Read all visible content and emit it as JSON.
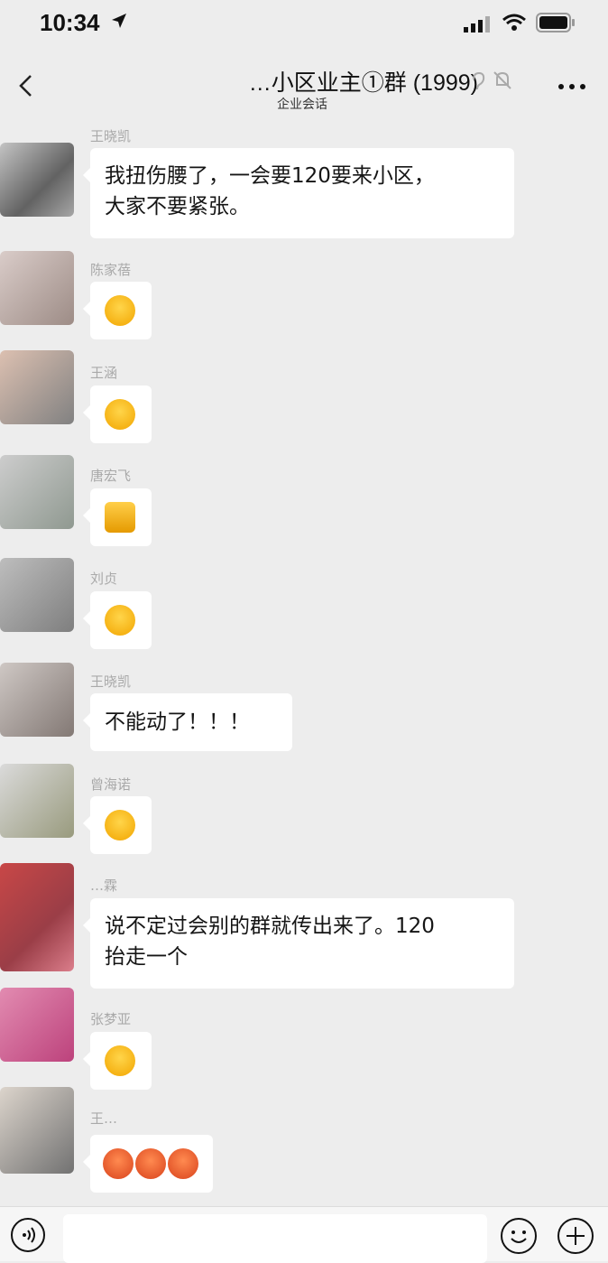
{
  "status_bar": {
    "time": "10:34"
  },
  "header": {
    "title": "…小区业主①群 (1999)",
    "subtitle": "企业会话",
    "icons": [
      "back-chevron-icon",
      "ear-icon",
      "mute-bell-icon",
      "more-icon"
    ]
  },
  "messages": [
    {
      "sender": "王晓凯",
      "text": "我扭伤腰了，一会要120要来小区，\n大家不要紧张。",
      "type": "text"
    },
    {
      "sender": "陈家蓓",
      "emoji": "facepalm-laugh-emoji",
      "type": "emoji"
    },
    {
      "sender": "王涵",
      "emoji": "facepalm-laugh-emoji",
      "type": "emoji"
    },
    {
      "sender": "唐宏飞",
      "emoji": "thumbs-up-emoji",
      "type": "emoji"
    },
    {
      "sender": "刘贞",
      "emoji": "grin-emoji",
      "type": "emoji"
    },
    {
      "sender": "王晓凯",
      "text": "不能动了！！！",
      "type": "text"
    },
    {
      "sender": "曾海诺",
      "emoji": "grin-sweat-emoji",
      "type": "emoji"
    },
    {
      "sender": "…霖",
      "text": "说不定过会别的群就传出来了。120\n抬走一个",
      "type": "text"
    },
    {
      "sender": "张梦亚",
      "emoji": "facepalm-laugh-emoji",
      "type": "emoji"
    },
    {
      "sender": "王…",
      "emoji": "sweat-face-emoji-x3",
      "type": "emoji"
    }
  ],
  "input_bar": {
    "placeholder": "",
    "icons": [
      "voice-icon",
      "emoji-icon",
      "plus-icon"
    ]
  },
  "colors": {
    "background": "#ededed",
    "bubble": "#ffffff",
    "sender": "#a9a9a9"
  }
}
